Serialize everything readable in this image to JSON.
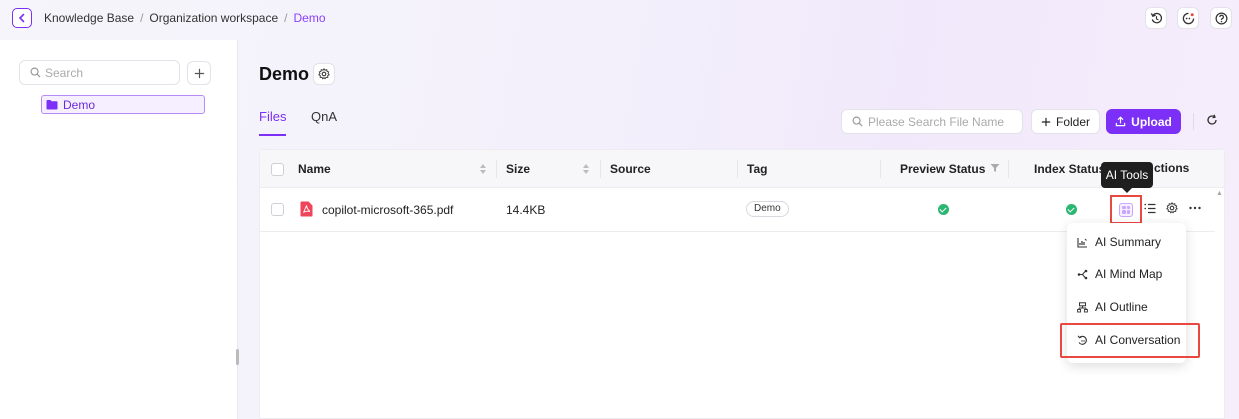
{
  "breadcrumb": {
    "items": [
      "Knowledge Base",
      "Organization workspace"
    ],
    "current": "Demo",
    "separator": "/"
  },
  "sidebar": {
    "search_placeholder": "Search",
    "tree": [
      {
        "label": "Demo",
        "selected": true
      }
    ]
  },
  "main": {
    "title": "Demo",
    "tabs": [
      {
        "label": "Files",
        "active": true
      },
      {
        "label": "QnA",
        "active": false
      }
    ],
    "file_search_placeholder": "Please Search File Name",
    "folder_label": "Folder",
    "upload_label": "Upload"
  },
  "table": {
    "columns": {
      "name": "Name",
      "size": "Size",
      "source": "Source",
      "tag": "Tag",
      "preview": "Preview Status",
      "index": "Index Status",
      "actions_suffix": "ctions"
    },
    "rows": [
      {
        "name": "copilot-microsoft-365.pdf",
        "size": "14.4KB",
        "source": "",
        "tag": "Demo",
        "preview_status": "success",
        "index_status": "success"
      }
    ]
  },
  "tooltip": {
    "label": "AI Tools"
  },
  "ai_menu": [
    {
      "label": "AI Summary",
      "icon": "summary-chart-icon"
    },
    {
      "label": "AI Mind Map",
      "icon": "mind-map-icon"
    },
    {
      "label": "AI Outline",
      "icon": "outline-tree-icon"
    },
    {
      "label": "AI Conversation",
      "icon": "conversation-icon",
      "highlighted": true
    }
  ],
  "colors": {
    "accent": "#7b2ff7",
    "highlight": "#e8483f",
    "success": "#2bb673"
  }
}
